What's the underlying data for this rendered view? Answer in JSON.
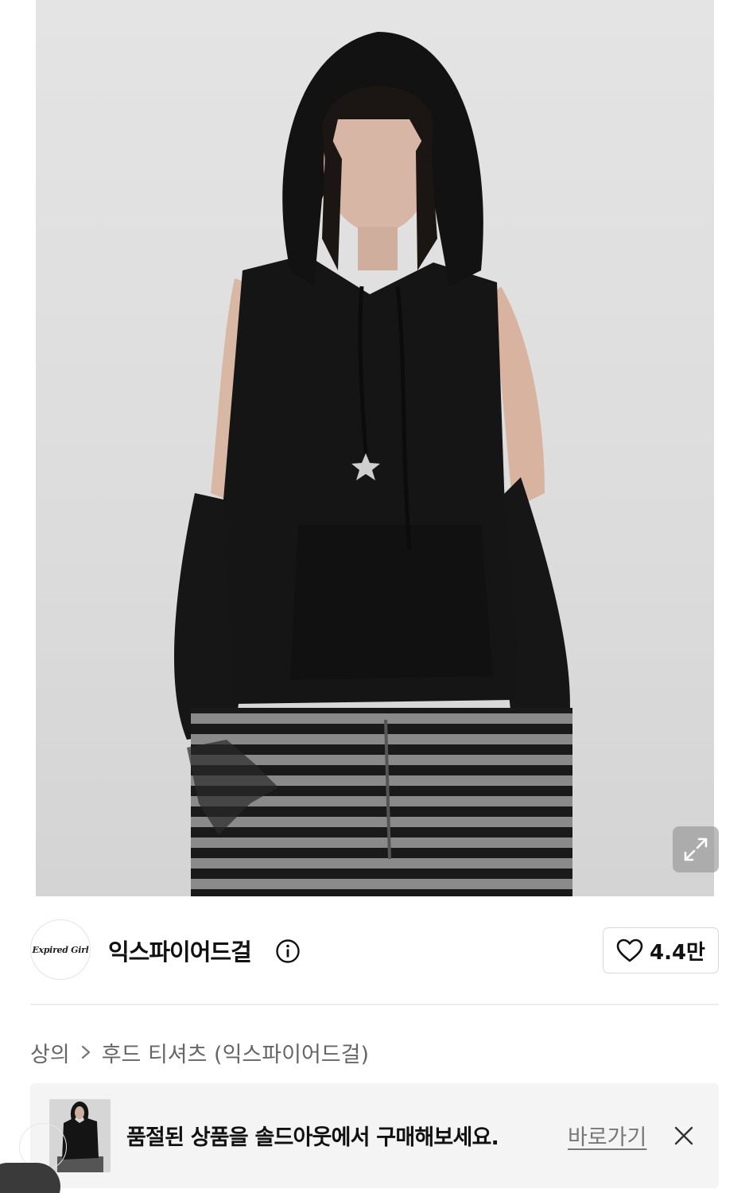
{
  "product_image": {
    "alt": "",
    "expand_icon": "expand-icon"
  },
  "brand": {
    "logo_text": "Expired Girl",
    "name": "익스파이어드걸",
    "info_icon": "info-icon"
  },
  "like": {
    "icon": "heart-icon",
    "count": "4.4만"
  },
  "breadcrumb": {
    "category": "상의",
    "separator_icon": "chevron-right-icon",
    "subcategory": "후드 티셔츠 (익스파이어드걸)"
  },
  "soldout_banner": {
    "message": "품절된 상품을 솔드아웃에서 구매해보세요.",
    "link_label": "바로가기",
    "close_icon": "close-icon"
  },
  "colors": {
    "background": "#ffffff",
    "photo_background": "#dedede",
    "banner_background": "#f4f4f4",
    "divider": "#ececec",
    "text_primary": "#111111",
    "text_secondary": "#666666"
  }
}
